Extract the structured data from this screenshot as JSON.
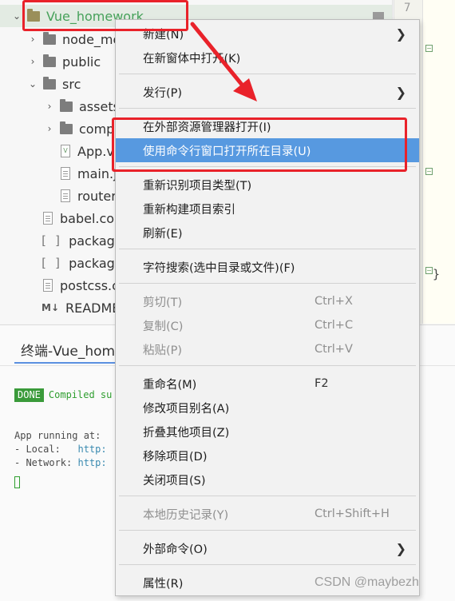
{
  "project_tree": {
    "items": [
      {
        "label": "Vue_homework",
        "type": "folder",
        "level": 0,
        "expanded": true,
        "root": true
      },
      {
        "label": "node_mo",
        "type": "folder",
        "level": 1,
        "expanded": false
      },
      {
        "label": "public",
        "type": "folder",
        "level": 1,
        "expanded": false
      },
      {
        "label": "src",
        "type": "folder",
        "level": 1,
        "expanded": true
      },
      {
        "label": "assets",
        "type": "folder",
        "level": 2,
        "expanded": false
      },
      {
        "label": "compo",
        "type": "folder",
        "level": 2,
        "expanded": false
      },
      {
        "label": "App.v",
        "type": "vue",
        "level": 2
      },
      {
        "label": "main.j",
        "type": "js",
        "level": 2
      },
      {
        "label": "router",
        "type": "js",
        "level": 2
      },
      {
        "label": "babel.co",
        "type": "js",
        "level": 1
      },
      {
        "label": "package.",
        "type": "json",
        "level": 1
      },
      {
        "label": "package-",
        "type": "json",
        "level": 1
      },
      {
        "label": "postcss.c",
        "type": "js",
        "level": 1
      },
      {
        "label": "README.",
        "type": "md",
        "level": 1
      }
    ]
  },
  "editor": {
    "line_number": "7",
    "brace": "}"
  },
  "terminal": {
    "tab_label": "终端-Vue_hom",
    "done_badge": "DONE",
    "compiled_text": "Compiled su",
    "running_text": "App running at:",
    "local_label": "- Local:   ",
    "local_url": "http:",
    "network_label": "- Network: ",
    "network_url": "http:"
  },
  "context_menu": {
    "items": [
      {
        "label": "新建(N)",
        "submenu": true
      },
      {
        "label": "在新窗体中打开(K)"
      },
      {
        "label": "发行(P)",
        "submenu": true
      },
      {
        "label": "在外部资源管理器打开(I)"
      },
      {
        "label": "使用命令行窗口打开所在目录(U)",
        "highlighted": true
      },
      {
        "label": "重新识别项目类型(T)"
      },
      {
        "label": "重新构建项目索引"
      },
      {
        "label": "刷新(E)"
      },
      {
        "label": "字符搜索(选中目录或文件)(F)"
      },
      {
        "label": "剪切(T)",
        "shortcut": "Ctrl+X",
        "disabled": true
      },
      {
        "label": "复制(C)",
        "shortcut": "Ctrl+C",
        "disabled": true
      },
      {
        "label": "粘贴(P)",
        "shortcut": "Ctrl+V",
        "disabled": true
      },
      {
        "label": "重命名(M)",
        "shortcut": "F2"
      },
      {
        "label": "修改项目别名(A)"
      },
      {
        "label": "折叠其他项目(Z)"
      },
      {
        "label": "移除项目(D)"
      },
      {
        "label": "关闭项目(S)"
      },
      {
        "label": "本地历史记录(Y)",
        "shortcut": "Ctrl+Shift+H",
        "disabled": true
      },
      {
        "label": "外部命令(O)",
        "submenu": true
      },
      {
        "label": "属性(R)"
      }
    ]
  },
  "watermark": "CSDN @maybezh",
  "colors": {
    "highlight": "#5799e0",
    "annotation_red": "#e9222a",
    "root_label_green": "#46a15a",
    "done_green": "#3a9a3a"
  }
}
